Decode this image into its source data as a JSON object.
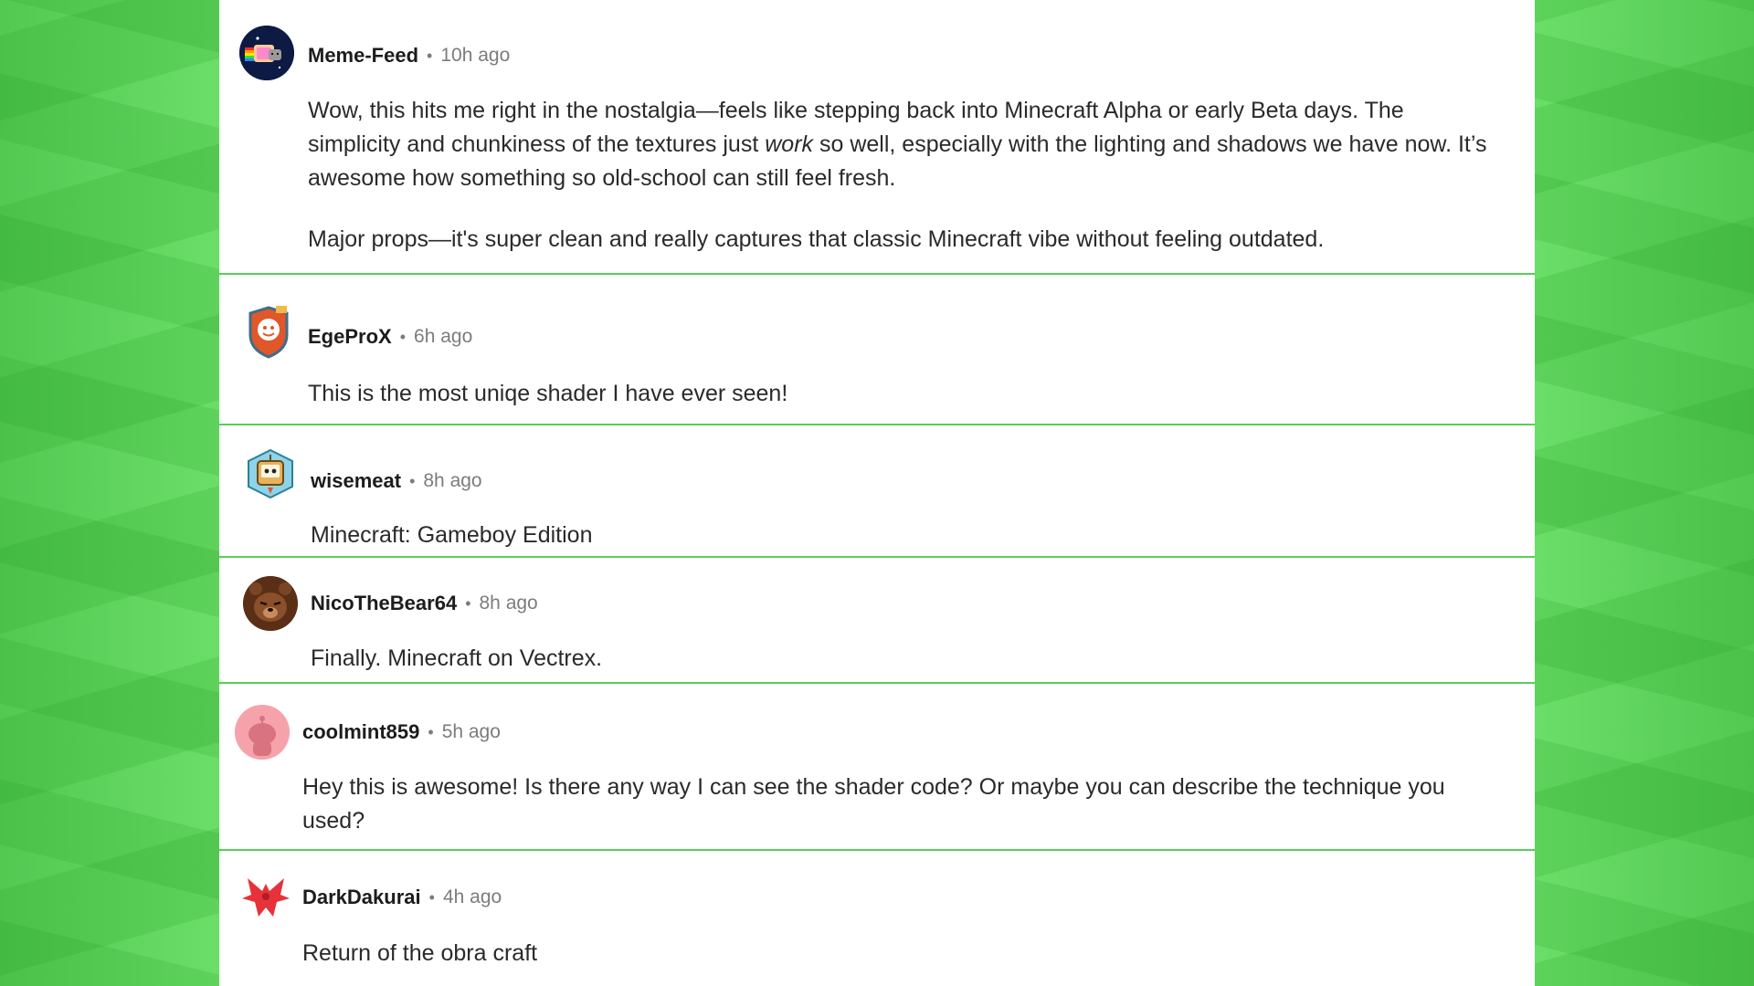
{
  "comments": [
    {
      "username": "Meme-Feed",
      "separator": "•",
      "time": "10h ago",
      "paragraphs": [
        {
          "pre": "Wow, this hits me right in the nostalgia—feels like stepping back into Minecraft Alpha or early Beta days. The simplicity and chunkiness of the textures just ",
          "em": "work",
          "post": " so well, especially with the lighting and shadows we have now. It’s awesome how something so old-school can still feel fresh."
        },
        {
          "text": "Major props—it's super clean and really captures that classic Minecraft vibe without feeling outdated."
        }
      ]
    },
    {
      "username": "EgeProX",
      "separator": "•",
      "time": "6h ago",
      "text": "This is the most uniqe shader I have ever seen!"
    },
    {
      "username": "wisemeat",
      "separator": "•",
      "time": "8h ago",
      "text": "Minecraft: Gameboy Edition"
    },
    {
      "username": "NicoTheBear64",
      "separator": "•",
      "time": "8h ago",
      "text": "Finally. Minecraft on Vectrex."
    },
    {
      "username": "coolmint859",
      "separator": "•",
      "time": "5h ago",
      "text": "Hey this is awesome! Is there any way I can see the shader code? Or maybe you can describe the technique you used?"
    },
    {
      "username": "DarkDakurai",
      "separator": "•",
      "time": "4h ago",
      "text": "Return of the obra craft"
    }
  ],
  "avatars": [
    "nyan-cat-avatar",
    "orange-shield-avatar",
    "tv-robot-avatar",
    "brown-bear-avatar",
    "pink-snoo-avatar",
    "red-bat-emblem-avatar"
  ],
  "colors": {
    "background_green": "#5fd85c",
    "divider_green": "#57cf57",
    "username": "#1c1c1c",
    "timestamp": "#7c7c7c",
    "body_text": "#2a2a2a"
  }
}
